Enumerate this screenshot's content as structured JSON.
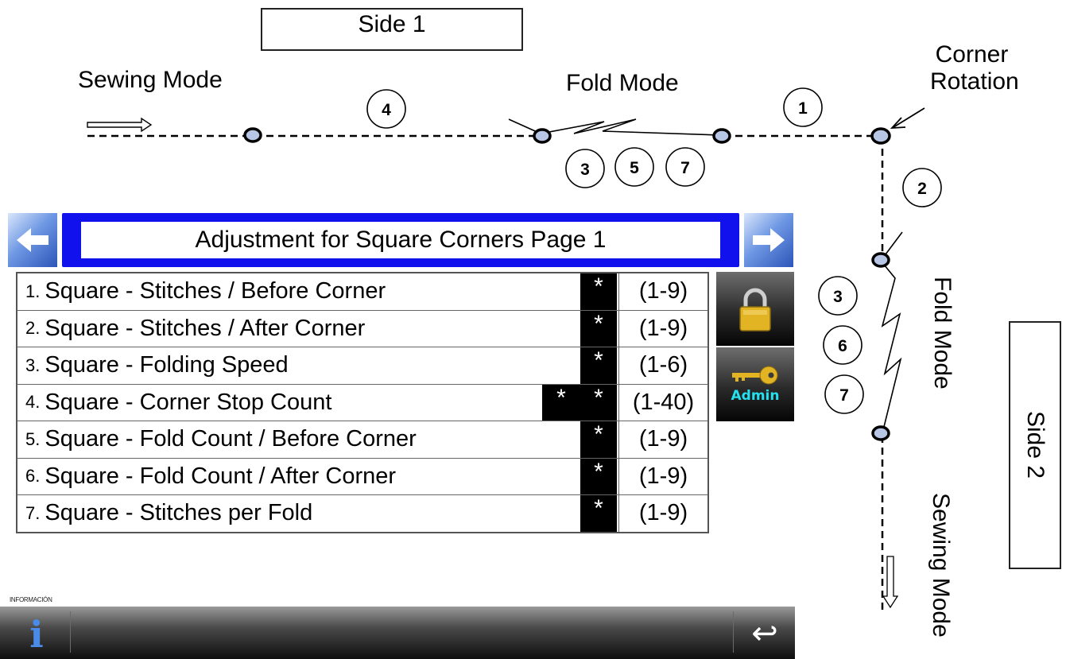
{
  "diagram": {
    "side1_label": "Side 1",
    "side2_label": "Side 2",
    "sewing_mode_top": "Sewing Mode",
    "fold_mode_top": "Fold Mode",
    "corner_rotation": "Corner\nRotation",
    "fold_mode_right": "Fold Mode",
    "sewing_mode_right": "Sewing Mode",
    "markers": {
      "m4": "4",
      "m1": "1",
      "m3": "3",
      "m5": "5",
      "m7": "7",
      "m2": "2",
      "r3": "3",
      "r6": "6",
      "r7": "7"
    }
  },
  "header": {
    "title": "Adjustment for  Square Corners Page 1",
    "prev_icon": "left-arrow-icon",
    "next_icon": "right-arrow-icon"
  },
  "params": [
    {
      "num": "1.",
      "label": "Square - Stitches / Before Corner",
      "value": "*",
      "range": "(1-9)"
    },
    {
      "num": "2.",
      "label": "Square - Stitches / After Corner",
      "value": "*",
      "range": "(1-9)"
    },
    {
      "num": "3.",
      "label": "Square - Folding Speed",
      "value": "*",
      "range": "(1-6)"
    },
    {
      "num": "4.",
      "label": "Square - Corner Stop Count",
      "value": "*",
      "value2": "*",
      "range": "(1-40)"
    },
    {
      "num": "5.",
      "label": "Square - Fold Count / Before Corner",
      "value": "*",
      "range": "(1-9)"
    },
    {
      "num": "6.",
      "label": "Square - Fold Count / After Corner",
      "value": "*",
      "range": "(1-9)"
    },
    {
      "num": "7.",
      "label": "Square - Stitches per Fold",
      "value": "*",
      "range": "(1-9)"
    }
  ],
  "side_buttons": {
    "lock_icon": "padlock-icon",
    "admin_label": "Admin",
    "admin_icon": "key-icon"
  },
  "bottom_bar": {
    "info_caption": "INFORMACIÓN",
    "info_glyph": "i",
    "back_glyph": "↩"
  },
  "colors": {
    "title_frame": "#1111ee",
    "nav_button": "#4a78d6",
    "admin_text": "#25e0ee",
    "lock_gold": "#e2b322",
    "info_blue": "#4a8be8"
  }
}
